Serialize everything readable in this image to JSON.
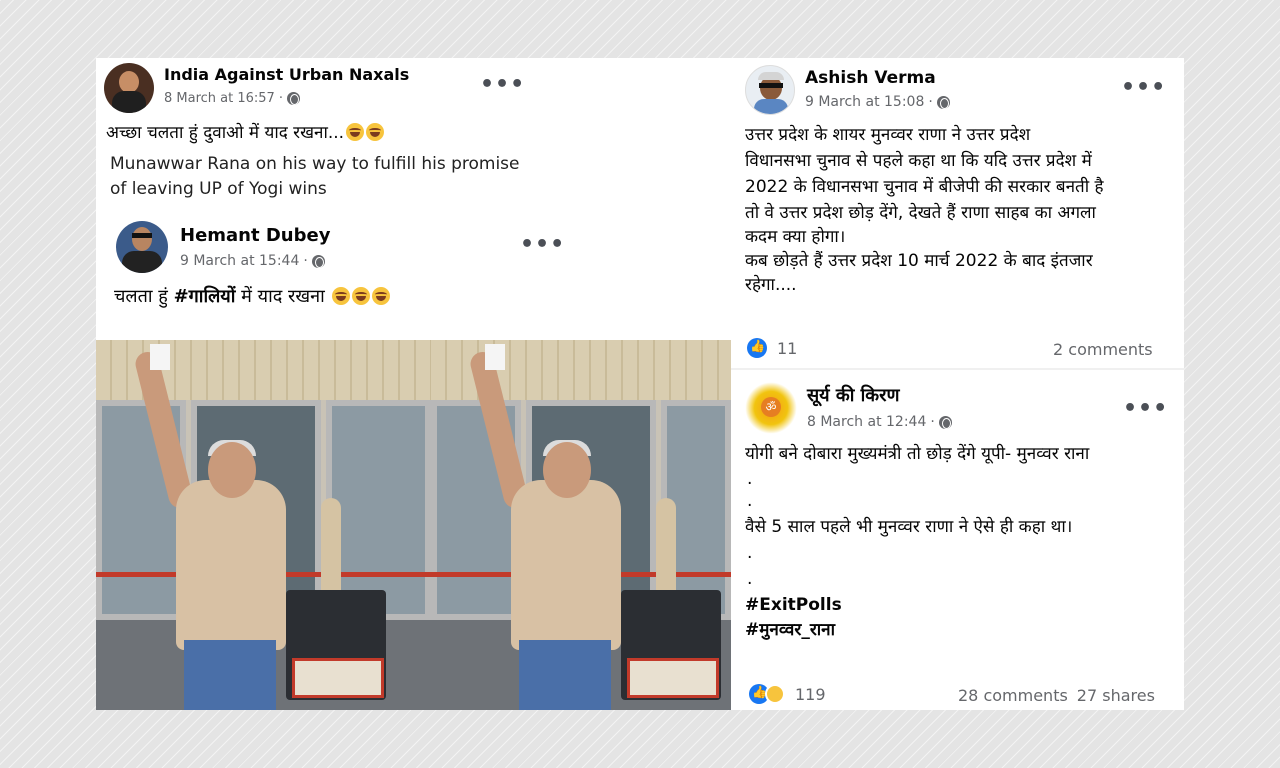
{
  "post1": {
    "author": "India Against Urban Naxals",
    "timestamp": "8 March at 16:57",
    "caption": "अच्छा चलता हुं दुवाओ में याद रखना...",
    "caption_emoji_count": 2,
    "quote_line1": "Munawwar Rana on his way to fulfill his promise",
    "quote_line2": "of leaving UP of Yogi wins"
  },
  "shared": {
    "author": "Hemant Dubey",
    "timestamp": "9 March at 15:44",
    "text_before": "चलता हुं ",
    "hashtag": "#गालियों",
    "text_after": " में याद रखना "
  },
  "post2": {
    "author": "Ashish Verma",
    "timestamp": "9 March at 15:08",
    "lines": [
      "उत्तर प्रदेश के शायर मुनव्वर राणा ने उत्तर प्रदेश",
      "विधानसभा चुनाव से पहले कहा था कि यदि उत्तर प्रदेश में",
      "2022 के विधानसभा चुनाव में बीजेपी की सरकार बनती है",
      "तो वे उत्तर प्रदेश छोड़ देंगे, देखते हैं राणा साहब का अगला",
      "कदम क्या होगा।",
      "कब छोड़ते हैं उत्तर प्रदेश 10 मार्च 2022 के बाद इंतजार",
      "रहेगा...."
    ],
    "reactions_count": "11",
    "comments": "2 comments"
  },
  "post3": {
    "author": "सूर्य की किरण",
    "timestamp": "8 March at 12:44",
    "line1": "योगी बने दोबारा मुख्यमंत्री तो छोड़ देंगे यूपी- मुनव्वर राना",
    "dot1": ".",
    "dot2": ".",
    "line2": "वैसे 5 साल पहले भी मुनव्वर राणा ने ऐसे ही कहा था।",
    "dot3": ".",
    "dot4": ".",
    "hashtag1": "#ExitPolls",
    "hashtag2": "#मुनव्वर_राना",
    "reactions_count": "119",
    "comments": "28 comments",
    "shares": "27 shares"
  },
  "icons": {
    "more": "more-options-icon",
    "privacy": "globe-icon",
    "like": "like-reaction-icon",
    "haha": "haha-reaction-icon"
  },
  "colors": {
    "facebook_blue": "#1877f2",
    "meta_gray": "#65676b"
  }
}
